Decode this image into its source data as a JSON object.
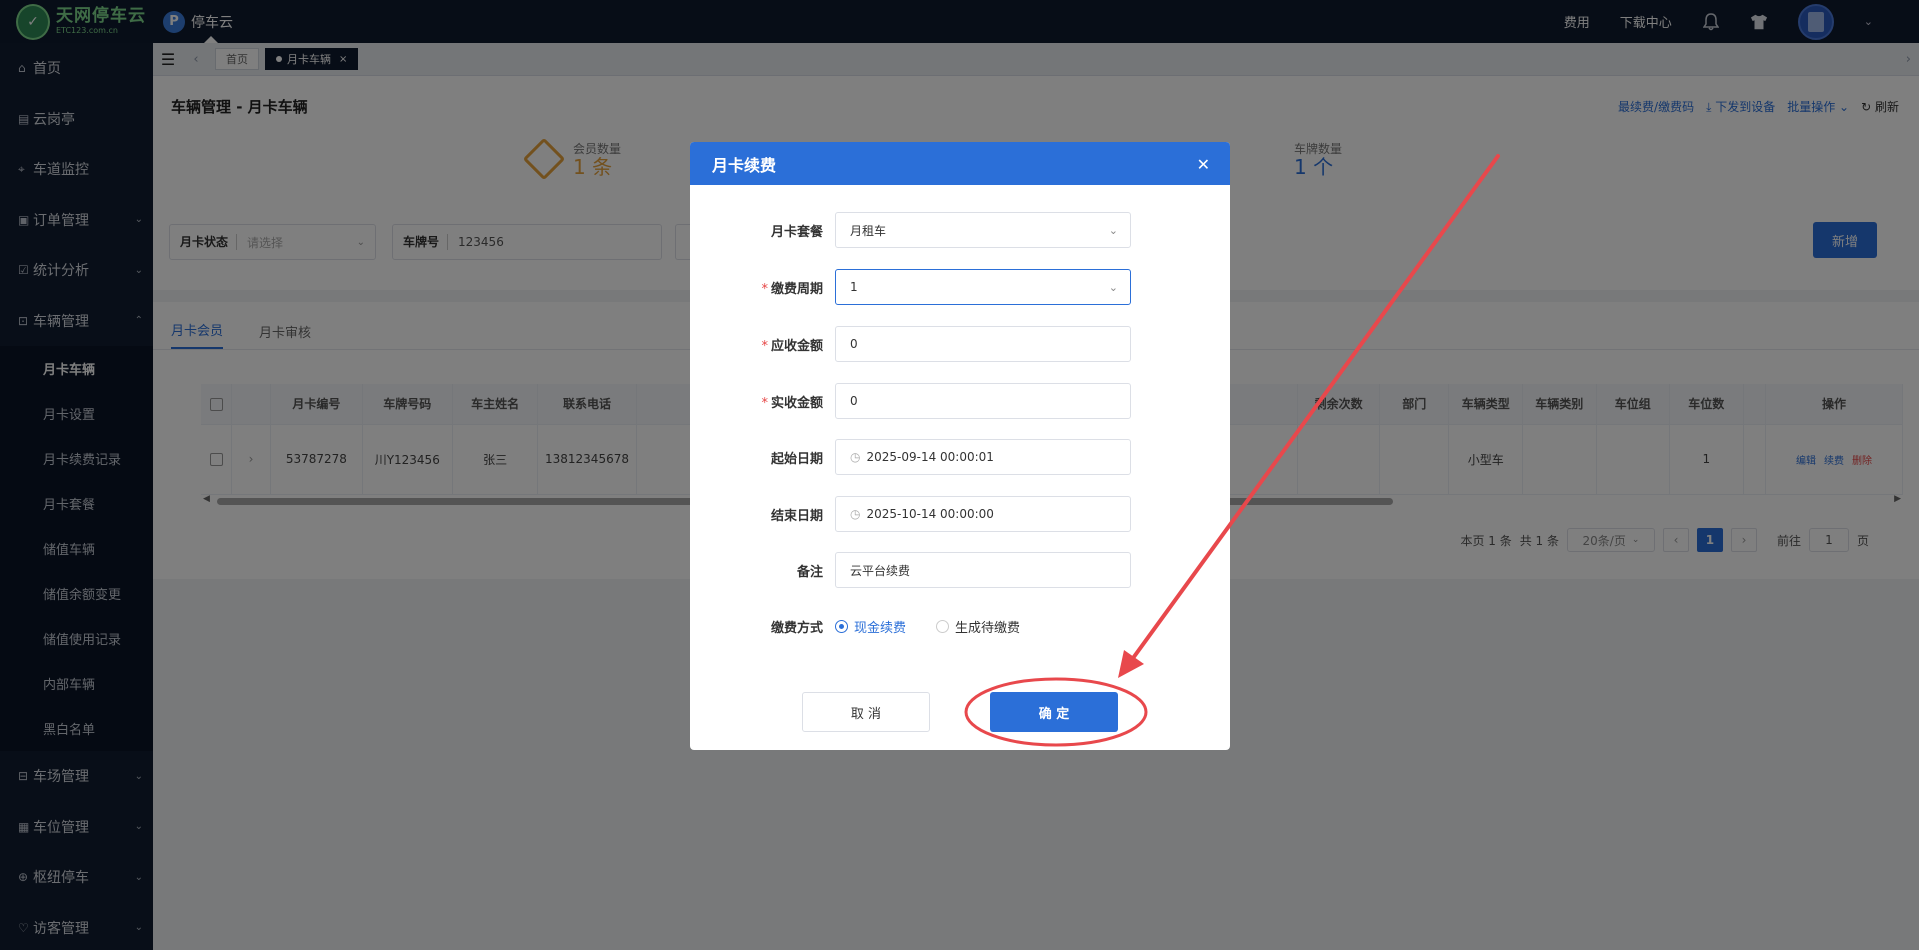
{
  "topbar": {
    "logo_title": "天网停车云",
    "logo_sub": "ETC123.com.cn",
    "app_name": "停车云",
    "links": [
      "费用",
      "下载中心"
    ]
  },
  "sidebar": {
    "items": [
      {
        "label": "首页",
        "icon": "home-icon"
      },
      {
        "label": "云岗亭",
        "icon": "booth-icon"
      },
      {
        "label": "车道监控",
        "icon": "monitor-icon"
      },
      {
        "label": "订单管理",
        "icon": "order-icon"
      },
      {
        "label": "统计分析",
        "icon": "chart-icon"
      },
      {
        "label": "车辆管理",
        "icon": "car-icon"
      }
    ],
    "sub_items": [
      "月卡车辆",
      "月卡设置",
      "月卡续费记录",
      "月卡套餐",
      "储值车辆",
      "储值余额变更",
      "储值使用记录",
      "内部车辆",
      "黑白名单"
    ],
    "bottom_items": [
      {
        "label": "车场管理",
        "icon": "lot-icon"
      },
      {
        "label": "车位管理",
        "icon": "space-icon"
      },
      {
        "label": "枢纽停车",
        "icon": "hub-icon"
      },
      {
        "label": "访客管理",
        "icon": "visitor-icon"
      }
    ]
  },
  "tabsbar": {
    "home": "首页",
    "current": "月卡车辆"
  },
  "page": {
    "title": "车辆管理 - 月卡车辆",
    "actions": [
      "最续费/缴费码",
      "下发到设备",
      "批量操作",
      "刷新"
    ],
    "stats": [
      {
        "label": "会员数量",
        "value": "1 条"
      },
      {
        "label": "车牌数量",
        "value": "1 个"
      }
    ],
    "filters": [
      {
        "label": "月卡状态",
        "value": "请选择"
      },
      {
        "label": "车牌号",
        "value": "123456"
      }
    ],
    "new_button": "新增",
    "tabs": [
      "月卡会员",
      "月卡审核"
    ]
  },
  "table": {
    "headers": [
      "",
      "",
      "月卡编号",
      "车牌号码",
      "车主姓名",
      "联系电话",
      "",
      "剩余次数",
      "部门",
      "车辆类型",
      "车辆类别",
      "车位组",
      "车位数",
      "",
      "操作"
    ],
    "row": [
      "",
      "›",
      "53787278",
      "川Y123456",
      "张三",
      "13812345678",
      "",
      "",
      "",
      "小型车",
      "",
      "",
      "1",
      "",
      ""
    ],
    "ops": [
      "编辑",
      "续费",
      "删除"
    ]
  },
  "pager": {
    "page_count": "本页 1 条",
    "total": "共 1 条",
    "page_size": "20条/页",
    "current": "1",
    "goto_label": "前往",
    "goto_value": "1",
    "goto_unit": "页"
  },
  "modal": {
    "title": "月卡续费",
    "fields": [
      {
        "label": "月卡套餐",
        "value": "月租车",
        "required": false
      },
      {
        "label": "缴费周期",
        "value": "1",
        "required": true
      },
      {
        "label": "应收金额",
        "value": "0",
        "required": true
      },
      {
        "label": "实收金额",
        "value": "0",
        "required": true
      },
      {
        "label": "起始日期",
        "value": "2025-09-14 00:00:01",
        "required": false
      },
      {
        "label": "结束日期",
        "value": "2025-10-14 00:00:00",
        "required": false
      },
      {
        "label": "备注",
        "value": "云平台续费",
        "required": false
      }
    ],
    "payment_label": "缴费方式",
    "payment_options": [
      "现金续费",
      "生成待缴费"
    ],
    "cancel": "取 消",
    "confirm": "确 定"
  },
  "colors": {
    "accent": "#2b6fd8",
    "annotation": "#e8484c",
    "sidebar": "#111d30"
  }
}
